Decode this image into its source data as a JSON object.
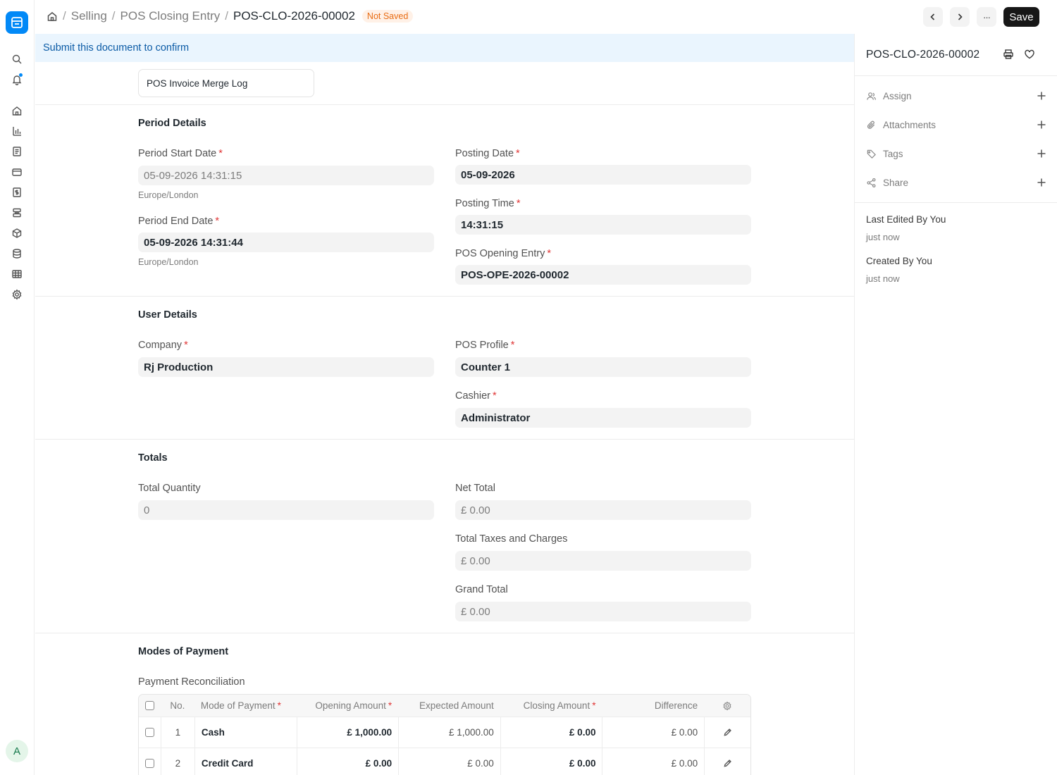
{
  "breadcrumb": {
    "items": [
      "Selling",
      "POS Closing Entry"
    ],
    "separator": "/",
    "current": "POS-CLO-2026-00002",
    "status_badge": "Not Saved"
  },
  "toolbar": {
    "save_label": "Save",
    "more_label": "···"
  },
  "alert": {
    "text": "Submit this document to confirm"
  },
  "merge_log": {
    "label": "POS Invoice Merge Log"
  },
  "sections": {
    "period": {
      "title": "Period Details",
      "period_start_label": "Period Start Date",
      "period_start_value": "05-09-2026 14:31:15",
      "period_start_tz": "Europe/London",
      "period_end_label": "Period End Date",
      "period_end_value": "05-09-2026 14:31:44",
      "period_end_tz": "Europe/London",
      "posting_date_label": "Posting Date",
      "posting_date_value": "05-09-2026",
      "posting_time_label": "Posting Time",
      "posting_time_value": "14:31:15",
      "opening_entry_label": "POS Opening Entry",
      "opening_entry_value": "POS-OPE-2026-00002"
    },
    "user": {
      "title": "User Details",
      "company_label": "Company",
      "company_value": "Rj Production",
      "pos_profile_label": "POS Profile",
      "pos_profile_value": "Counter 1",
      "cashier_label": "Cashier",
      "cashier_value": "Administrator"
    },
    "totals": {
      "title": "Totals",
      "total_qty_label": "Total Quantity",
      "total_qty_value": "0",
      "net_total_label": "Net Total",
      "net_total_value": "£ 0.00",
      "taxes_label": "Total Taxes and Charges",
      "taxes_value": "£ 0.00",
      "grand_total_label": "Grand Total",
      "grand_total_value": "£ 0.00"
    },
    "payments": {
      "title": "Modes of Payment",
      "table_label": "Payment Reconciliation",
      "columns": {
        "no": "No.",
        "mode": "Mode of Payment",
        "opening": "Opening Amount",
        "expected": "Expected Amount",
        "closing": "Closing Amount",
        "difference": "Difference"
      },
      "rows": [
        {
          "no": "1",
          "mode": "Cash",
          "opening": "£ 1,000.00",
          "expected": "£ 1,000.00",
          "closing": "£ 0.00",
          "difference": "£ 0.00"
        },
        {
          "no": "2",
          "mode": "Credit Card",
          "opening": "£ 0.00",
          "expected": "£ 0.00",
          "closing": "£ 0.00",
          "difference": "£ 0.00"
        }
      ]
    }
  },
  "required_mark": "*",
  "sidebar": {
    "title": "POS-CLO-2026-00002",
    "actions": [
      "Assign",
      "Attachments",
      "Tags",
      "Share"
    ],
    "last_edited_label": "Last Edited By You",
    "last_edited_value": "just now",
    "created_label": "Created By You",
    "created_value": "just now"
  },
  "user": {
    "avatar_initial": "A"
  },
  "colors": {
    "accent": "#0289f7",
    "badge_text": "#e86c13",
    "badge_bg": "#fff1e7",
    "required": "#e03636",
    "alert_bg": "#eaf5fe",
    "alert_text": "#0b5ba6",
    "primary_button": "#171717"
  }
}
